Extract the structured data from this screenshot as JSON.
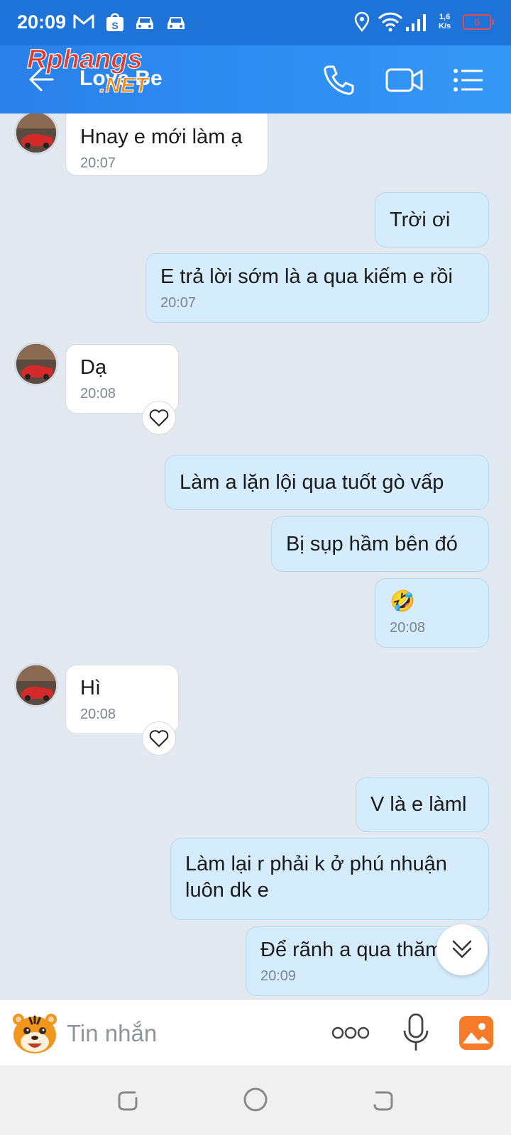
{
  "status_bar": {
    "time": "20:09",
    "speed_value": "1,6",
    "speed_unit": "K/s",
    "battery": "6"
  },
  "header": {
    "title": "Love Be",
    "watermark": "Rphangs.NET",
    "icons": [
      "back-arrow-icon",
      "phone-icon",
      "video-call-icon",
      "menu-list-icon"
    ]
  },
  "messages": [
    {
      "side": "in",
      "text": "Hnay e mới làm ạ",
      "time": "20:07"
    },
    {
      "side": "out",
      "text": "Trời ơi",
      "time": ""
    },
    {
      "side": "out",
      "text": "E trả lời sớm là a qua kiếm e rồi",
      "time": "20:07"
    },
    {
      "side": "in",
      "text": "Dạ",
      "time": "20:08"
    },
    {
      "side": "out",
      "text": "Làm a lặn lội qua tuốt gò vấp",
      "time": ""
    },
    {
      "side": "out",
      "text": "Bị sụp hầm bên đó",
      "time": ""
    },
    {
      "side": "out",
      "text": "🤣",
      "time": "20:08"
    },
    {
      "side": "in",
      "text": "Hì",
      "time": "20:08"
    },
    {
      "side": "out",
      "text": "V là e làml",
      "time": ""
    },
    {
      "side": "out",
      "text": "Làm lại r phải k ở phú nhuận luôn dk e",
      "time": ""
    },
    {
      "side": "out",
      "text": "Để rãnh a qua thăm",
      "time": "20:09"
    }
  ],
  "composer": {
    "placeholder": "Tin nhắn",
    "icons": [
      "tiger-sticker-icon",
      "more-dots-icon",
      "microphone-icon",
      "gallery-image-icon"
    ]
  },
  "colors": {
    "header_blue": "#2e8df2",
    "incoming_bubble": "#ffffff",
    "outgoing_bubble": "#d5ecfd",
    "chat_background": "#e2e9f1"
  }
}
